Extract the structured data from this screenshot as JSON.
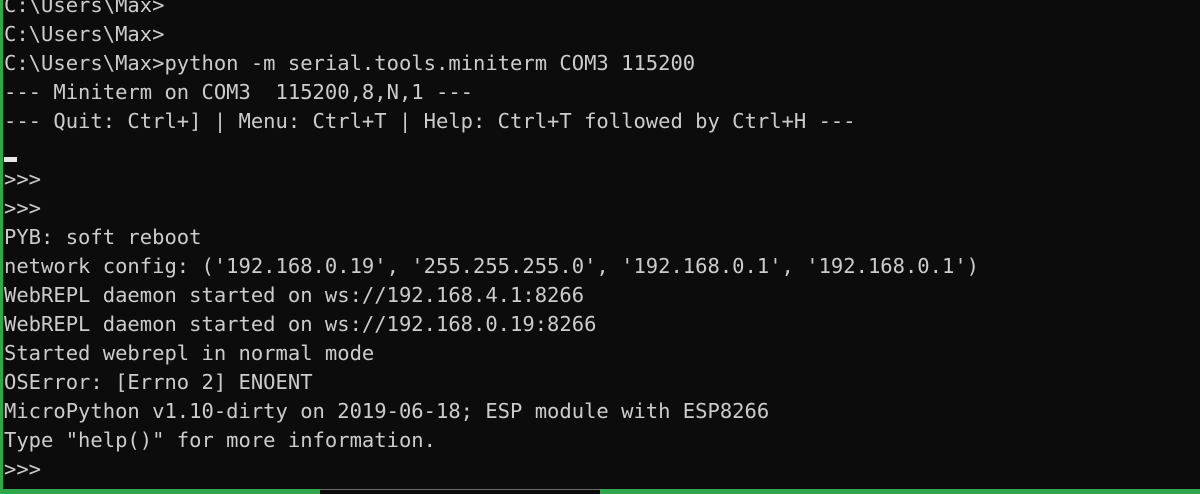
{
  "terminal": {
    "lines": [
      "C:\\Users\\Max>",
      "C:\\Users\\Max>",
      "C:\\Users\\Max>python -m serial.tools.miniterm COM3 115200",
      "--- Miniterm on COM3  115200,8,N,1 ---",
      "--- Quit: Ctrl+] | Menu: Ctrl+T | Help: Ctrl+T followed by Ctrl+H ---",
      "",
      ">>>",
      ">>>",
      "PYB: soft reboot",
      "network config: ('192.168.0.19', '255.255.255.0', '192.168.0.1', '192.168.0.1')",
      "WebREPL daemon started on ws://192.168.4.1:8266",
      "WebREPL daemon started on ws://192.168.0.19:8266",
      "Started webrepl in normal mode",
      "OSError: [Errno 2] ENOENT",
      "MicroPython v1.10-dirty on 2019-06-18; ESP module with ESP8266",
      "Type \"help()\" for more information.",
      ">>>"
    ]
  },
  "colors": {
    "background": "#0c0c0c",
    "text": "#cccccc",
    "border": "#2ea84a"
  }
}
